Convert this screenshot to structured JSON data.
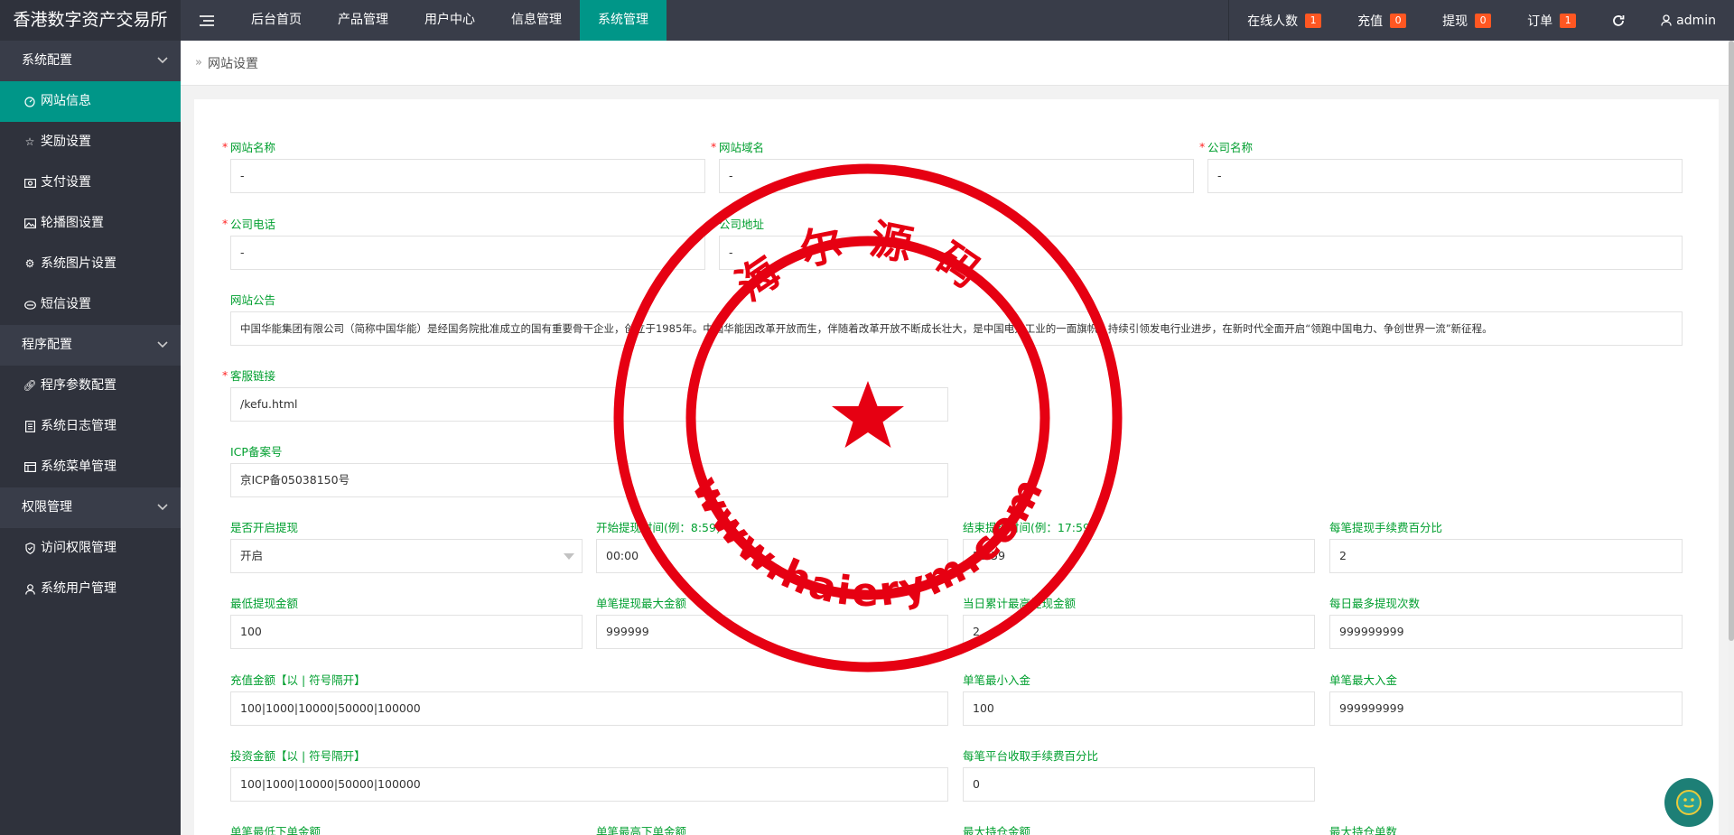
{
  "app": {
    "title": "香港数字资产交易所"
  },
  "topnav": {
    "items": [
      {
        "label": "后台首页"
      },
      {
        "label": "产品管理"
      },
      {
        "label": "用户中心"
      },
      {
        "label": "信息管理"
      },
      {
        "label": "系统管理",
        "active": true
      }
    ]
  },
  "topright": {
    "online": {
      "label": "在线人数",
      "count": "1"
    },
    "recharge": {
      "label": "充值",
      "count": "0"
    },
    "withdraw": {
      "label": "提现",
      "count": "0"
    },
    "orders": {
      "label": "订单",
      "count": "1"
    },
    "user": "admin"
  },
  "sidebar": {
    "groups": [
      {
        "title": "系统配置",
        "items": [
          {
            "label": "网站信息",
            "icon": "dashboard-icon",
            "active": true
          },
          {
            "label": "奖励设置",
            "icon": "star-icon"
          },
          {
            "label": "支付设置",
            "icon": "money-icon"
          },
          {
            "label": "轮播图设置",
            "icon": "image-icon"
          },
          {
            "label": "系统图片设置",
            "icon": "gear-icon"
          },
          {
            "label": "短信设置",
            "icon": "eye-icon"
          }
        ]
      },
      {
        "title": "程序配置",
        "items": [
          {
            "label": "程序参数配置",
            "icon": "link-icon"
          },
          {
            "label": "系统日志管理",
            "icon": "log-icon"
          },
          {
            "label": "系统菜单管理",
            "icon": "menu-icon"
          }
        ]
      },
      {
        "title": "权限管理",
        "items": [
          {
            "label": "访问权限管理",
            "icon": "shield-icon"
          },
          {
            "label": "系统用户管理",
            "icon": "user-icon"
          }
        ]
      }
    ]
  },
  "breadcrumb": {
    "label": "网站设置"
  },
  "form": {
    "site_name": {
      "label": "网站名称",
      "value": "-"
    },
    "site_domain": {
      "label": "网站域名",
      "value": "-"
    },
    "company_name": {
      "label": "公司名称",
      "value": "-"
    },
    "company_phone": {
      "label": "公司电话",
      "value": "-"
    },
    "company_address": {
      "label": "公司地址",
      "value": "-"
    },
    "notice": {
      "label": "网站公告",
      "value": "中国华能集团有限公司（简称中国华能）是经国务院批准成立的国有重要骨干企业，创立于1985年。中国华能因改革开放而生，伴随着改革开放不断成长壮大，是中国电力工业的一面旗帜，持续引领发电行业进步，在新时代全面开启“领跑中国电力、争创世界一流”新征程。"
    },
    "service_link": {
      "label": "客服链接",
      "value": "/kefu.html"
    },
    "icp": {
      "label": "ICP备案号",
      "value": "京ICP备05038150号"
    },
    "withdraw_enabled": {
      "label": "是否开启提现",
      "value": "开启"
    },
    "withdraw_start": {
      "label": "开始提现时间(例：8:59)",
      "value": "00:00"
    },
    "withdraw_end": {
      "label": "结束提现时间(例：17:59)",
      "value": "23:59"
    },
    "withdraw_fee": {
      "label": "每笔提现手续费百分比",
      "value": "2"
    },
    "withdraw_min": {
      "label": "最低提现金额",
      "value": "100"
    },
    "withdraw_max_single": {
      "label": "单笔提现最大金额",
      "value": "999999"
    },
    "withdraw_max_daily": {
      "label": "当日累计最高提现金额",
      "value": "2"
    },
    "withdraw_times": {
      "label": "每日最多提现次数",
      "value": "999999999"
    },
    "recharge_amounts": {
      "label": "充值金额【以 | 符号隔开】",
      "value": "100|1000|10000|50000|100000"
    },
    "deposit_min": {
      "label": "单笔最小入金",
      "value": "100"
    },
    "deposit_max": {
      "label": "单笔最大入金",
      "value": "999999999"
    },
    "invest_amounts": {
      "label": "投资金额【以 | 符号隔开】",
      "value": "100|1000|10000|50000|100000"
    },
    "platform_fee": {
      "label": "每笔平台收取手续费百分比",
      "value": "0"
    },
    "row_partial": [
      {
        "label": "单笔最低下单金额"
      },
      {
        "label": "单笔最高下单金额"
      },
      {
        "label": "最大持仓金额"
      },
      {
        "label": "最大持仓单数"
      }
    ]
  },
  "watermark": {
    "top_text": "海尔源码",
    "bottom_text": "www.haierym.com",
    "color": "#e60012"
  },
  "colors": {
    "accent": "#009688",
    "topbar": "#393d49",
    "sidebar": "#2f323c",
    "label": "#009f2f",
    "badge": "#ff5722"
  }
}
